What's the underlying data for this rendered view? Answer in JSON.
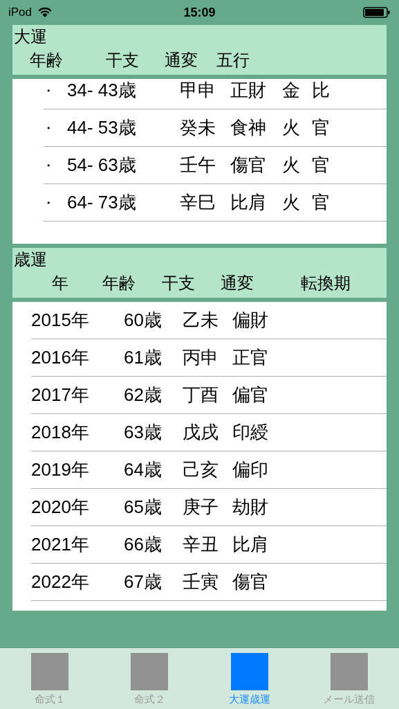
{
  "status_bar": {
    "carrier": "iPod",
    "time": "15:09"
  },
  "daiun": {
    "title": "大運",
    "columns": [
      "年齢",
      "干支",
      "通変",
      "五行"
    ],
    "rows": [
      {
        "bullet": "・",
        "age": "34- 43歳",
        "ganzhi": "甲申",
        "tsuhen": "正財",
        "gogyo": "金",
        "column_5": "比"
      },
      {
        "bullet": "・",
        "age": "44- 53歳",
        "ganzhi": "癸未",
        "tsuhen": "食神",
        "gogyo": "火",
        "column_5": "官"
      },
      {
        "bullet": "・",
        "age": "54- 63歳",
        "ganzhi": "壬午",
        "tsuhen": "傷官",
        "gogyo": "火",
        "column_5": "官"
      },
      {
        "bullet": "・",
        "age": "64- 73歳",
        "ganzhi": "辛巳",
        "tsuhen": "比肩",
        "gogyo": "火",
        "column_5": "官"
      }
    ]
  },
  "saiun": {
    "title": "歳運",
    "columns": [
      "年",
      "年齢",
      "干支",
      "通変",
      "転換期"
    ],
    "rows": [
      {
        "year": "2015年",
        "age": "60歳",
        "ganzhi": "乙未",
        "tsuhen": "偏財"
      },
      {
        "year": "2016年",
        "age": "61歳",
        "ganzhi": "丙申",
        "tsuhen": "正官"
      },
      {
        "year": "2017年",
        "age": "62歳",
        "ganzhi": "丁酉",
        "tsuhen": "偏官"
      },
      {
        "year": "2018年",
        "age": "63歳",
        "ganzhi": "戊戌",
        "tsuhen": "印綬"
      },
      {
        "year": "2019年",
        "age": "64歳",
        "ganzhi": "己亥",
        "tsuhen": "偏印"
      },
      {
        "year": "2020年",
        "age": "65歳",
        "ganzhi": "庚子",
        "tsuhen": "劫財"
      },
      {
        "year": "2021年",
        "age": "66歳",
        "ganzhi": "辛丑",
        "tsuhen": "比肩"
      },
      {
        "year": "2022年",
        "age": "67歳",
        "ganzhi": "壬寅",
        "tsuhen": "傷官"
      }
    ]
  },
  "tabs": [
    {
      "label": "命式１",
      "selected": false
    },
    {
      "label": "命式２",
      "selected": false
    },
    {
      "label": "大運歳運",
      "selected": true
    },
    {
      "label": "メール送信",
      "selected": false
    }
  ]
}
